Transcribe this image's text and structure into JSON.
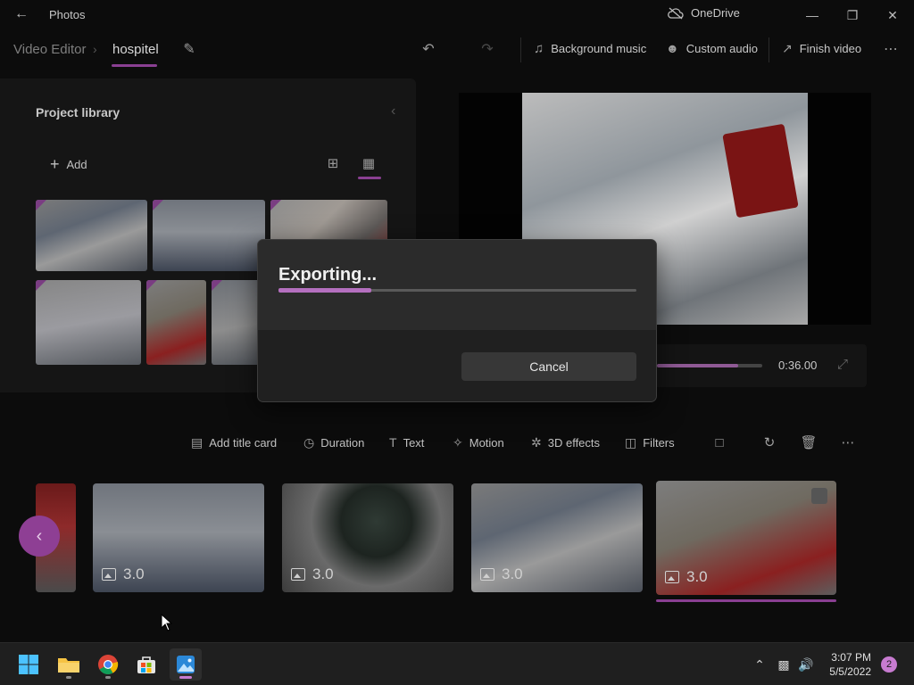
{
  "titlebar": {
    "app_title": "Photos",
    "onedrive_label": "OneDrive",
    "icons": [
      "back-arrow-icon",
      "cloud-off-icon",
      "minimize-icon",
      "maximize-icon",
      "close-icon"
    ]
  },
  "commandbar": {
    "breadcrumb_root": "Video Editor",
    "breadcrumb_current": "hospitel",
    "background_music": "Background music",
    "custom_audio": "Custom audio",
    "finish_video": "Finish video"
  },
  "library": {
    "title": "Project library",
    "add_label": "Add"
  },
  "playback": {
    "time": "0:36.00",
    "progress_fraction": 0.77
  },
  "storyboard_toolbar": {
    "add_title_card": "Add title card",
    "duration": "Duration",
    "text": "Text",
    "motion": "Motion",
    "effects_3d": "3D effects",
    "filters": "Filters"
  },
  "storyboard": {
    "clips": [
      {
        "duration": "3.0"
      },
      {
        "duration": "3.0"
      },
      {
        "duration": "3.0"
      },
      {
        "duration": "3.0"
      }
    ]
  },
  "dialog": {
    "heading": "Exporting...",
    "progress_fraction": 0.26,
    "cancel_label": "Cancel"
  },
  "taskbar": {
    "time": "3:07 PM",
    "date": "5/5/2022",
    "notification_count": "2"
  },
  "colors": {
    "accent": "#8a3f92",
    "progress": "#b46fbf"
  }
}
